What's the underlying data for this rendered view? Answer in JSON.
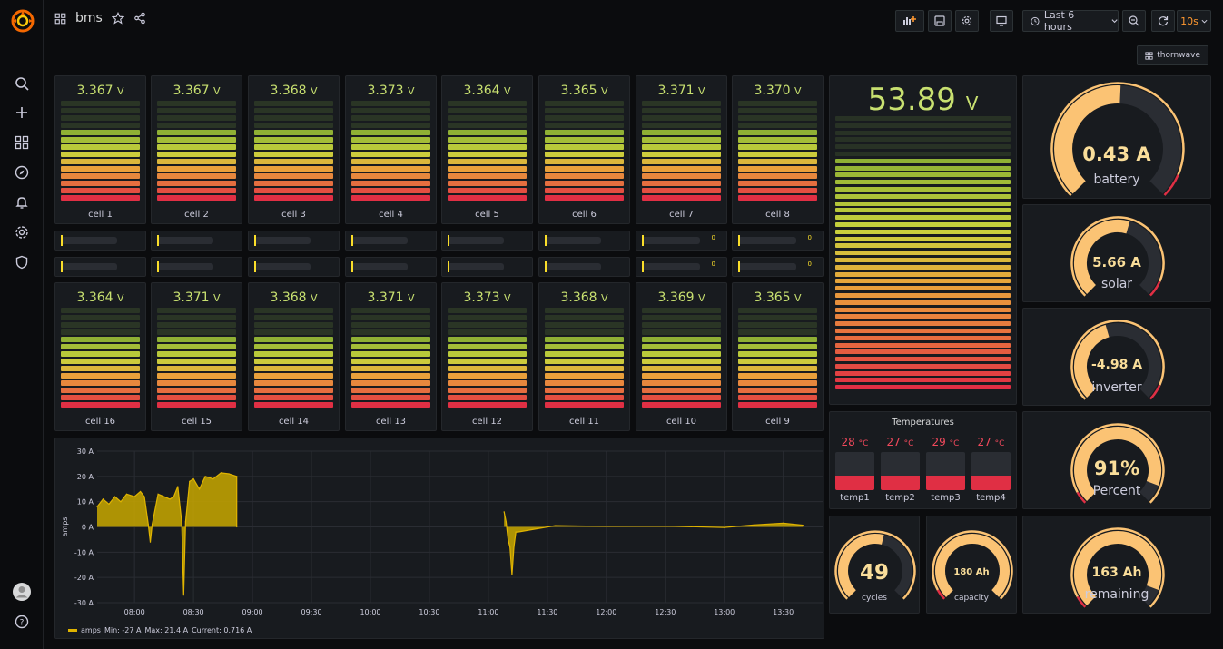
{
  "dashboard": {
    "title": "bms"
  },
  "toolbar": {
    "time_range": "Last 6 hours",
    "refresh": "10s",
    "user": "thornwave"
  },
  "colors": {
    "accent": "#ff9830",
    "green": "#c8e070",
    "red": "#f2495c",
    "yellow": "#fade2a"
  },
  "cells_top": [
    {
      "label": "cell 1",
      "value": "3.367",
      "unit": "V"
    },
    {
      "label": "cell 2",
      "value": "3.367",
      "unit": "V"
    },
    {
      "label": "cell 3",
      "value": "3.368",
      "unit": "V"
    },
    {
      "label": "cell 4",
      "value": "3.373",
      "unit": "V"
    },
    {
      "label": "cell 5",
      "value": "3.364",
      "unit": "V"
    },
    {
      "label": "cell 6",
      "value": "3.365",
      "unit": "V"
    },
    {
      "label": "cell 7",
      "value": "3.371",
      "unit": "V"
    },
    {
      "label": "cell 8",
      "value": "3.370",
      "unit": "V"
    }
  ],
  "cells_bottom": [
    {
      "label": "cell 16",
      "value": "3.364",
      "unit": "V"
    },
    {
      "label": "cell 15",
      "value": "3.371",
      "unit": "V"
    },
    {
      "label": "cell 14",
      "value": "3.368",
      "unit": "V"
    },
    {
      "label": "cell 13",
      "value": "3.371",
      "unit": "V"
    },
    {
      "label": "cell 12",
      "value": "3.373",
      "unit": "V"
    },
    {
      "label": "cell 11",
      "value": "3.368",
      "unit": "V"
    },
    {
      "label": "cell 10",
      "value": "3.369",
      "unit": "V"
    },
    {
      "label": "cell 9",
      "value": "3.365",
      "unit": "V"
    }
  ],
  "balance_rows": [
    [
      "",
      "",
      "",
      "",
      "",
      "",
      "0",
      "0"
    ],
    [
      "",
      "",
      "",
      "",
      "",
      "",
      "0",
      "0"
    ]
  ],
  "pack_voltage": {
    "value": "53.89",
    "unit": "V"
  },
  "gauges": {
    "battery": {
      "value": "0.43 A",
      "label": "battery",
      "fraction": 0.51
    },
    "solar": {
      "value": "5.66 A",
      "label": "solar",
      "fraction": 0.56
    },
    "inverter": {
      "value": "-4.98 A",
      "label": "inverter",
      "fraction": 0.44
    },
    "percent": {
      "value": "91%",
      "label": "Percent",
      "fraction": 0.91
    },
    "cycles": {
      "value": "49",
      "label": "cycles",
      "fraction": 0.55
    },
    "capacity": {
      "value": "180 Ah",
      "label": "capacity",
      "fraction": 1.0
    },
    "remaining": {
      "value": "163 Ah",
      "label": "remaining",
      "fraction": 0.91
    }
  },
  "temperatures": {
    "title": "Temperatures",
    "items": [
      {
        "label": "temp1",
        "value": "28",
        "unit": "°C"
      },
      {
        "label": "temp2",
        "value": "27",
        "unit": "°C"
      },
      {
        "label": "temp3",
        "value": "29",
        "unit": "°C"
      },
      {
        "label": "temp4",
        "value": "27",
        "unit": "°C"
      }
    ]
  },
  "chart_data": {
    "type": "area",
    "ylabel": "amps",
    "ylim": [
      -30,
      30
    ],
    "yticks": [
      "30 A",
      "20 A",
      "10 A",
      "0 A",
      "-10 A",
      "-20 A",
      "-30 A"
    ],
    "xticks": [
      "08:00",
      "08:30",
      "09:00",
      "09:30",
      "10:00",
      "10:30",
      "11:00",
      "11:30",
      "12:00",
      "12:30",
      "13:00",
      "13:30"
    ],
    "series": [
      {
        "name": "amps",
        "points": [
          [
            "07:41",
            8
          ],
          [
            "07:44",
            11
          ],
          [
            "07:47",
            9
          ],
          [
            "07:50",
            12
          ],
          [
            "07:53",
            10
          ],
          [
            "07:56",
            13
          ],
          [
            "08:00",
            12
          ],
          [
            "08:03",
            14
          ],
          [
            "08:05",
            12
          ],
          [
            "08:07",
            1
          ],
          [
            "08:08",
            -6
          ],
          [
            "08:09",
            1
          ],
          [
            "08:12",
            13
          ],
          [
            "08:15",
            12
          ],
          [
            "08:18",
            11
          ],
          [
            "08:20",
            12
          ],
          [
            "08:22",
            16
          ],
          [
            "08:24",
            2
          ],
          [
            "08:25",
            -27
          ],
          [
            "08:26",
            2
          ],
          [
            "08:28",
            18
          ],
          [
            "08:30",
            19
          ],
          [
            "08:33",
            15
          ],
          [
            "08:36",
            20
          ],
          [
            "08:40",
            19
          ],
          [
            "08:44",
            21.4
          ],
          [
            "08:48",
            21
          ],
          [
            "08:52",
            20
          ],
          [
            "08:52",
            0
          ],
          [
            "11:08",
            6
          ],
          [
            "11:09",
            2
          ],
          [
            "11:10",
            -5
          ],
          [
            "11:11",
            -8
          ],
          [
            "11:12",
            -19
          ],
          [
            "11:13",
            -8
          ],
          [
            "11:14",
            -2
          ],
          [
            "11:15",
            -2
          ],
          [
            "11:34",
            0.5
          ],
          [
            "12:00",
            0.2
          ],
          [
            "12:30",
            0.3
          ],
          [
            "13:00",
            -0.2
          ],
          [
            "13:15",
            0.8
          ],
          [
            "13:30",
            1.5
          ],
          [
            "13:40",
            0.7
          ]
        ]
      }
    ],
    "legend": {
      "name": "amps",
      "min": "Min: -27 A",
      "max": "Max: 21.4 A",
      "current": "Current: 0.716 A"
    }
  }
}
